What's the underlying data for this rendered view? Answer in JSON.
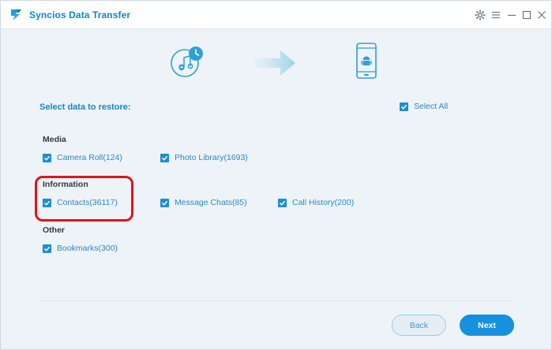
{
  "window": {
    "title": "Syncios Data Transfer",
    "controls": [
      "gear-icon",
      "menu-icon",
      "minimize-icon",
      "maximize-icon",
      "close-icon"
    ]
  },
  "flow": {
    "source_icon": "itunes-backup-icon",
    "arrow_icon": "arrow-right-icon",
    "target_icon": "android-phone-icon"
  },
  "restore": {
    "heading": "Select data to restore:",
    "select_all": {
      "label": "Select All",
      "checked": true
    }
  },
  "groups": {
    "media": {
      "label": "Media",
      "options": [
        {
          "label": "Camera Roll(124)",
          "checked": true
        },
        {
          "label": "Photo Library(1693)",
          "checked": true
        }
      ]
    },
    "information": {
      "label": "Information",
      "options": [
        {
          "label": "Contacts(36117)",
          "checked": true
        },
        {
          "label": "Message Chats(85)",
          "checked": true
        },
        {
          "label": "Call History(200)",
          "checked": true
        }
      ]
    },
    "other": {
      "label": "Other",
      "options": [
        {
          "label": "Bookmarks(300)",
          "checked": true
        }
      ]
    }
  },
  "buttons": {
    "back": "Back",
    "next": "Next"
  },
  "colors": {
    "accent": "#1591e0",
    "checkbox": "#1c8fd1",
    "highlight": "#e0141b",
    "background": "#eef3f7"
  }
}
